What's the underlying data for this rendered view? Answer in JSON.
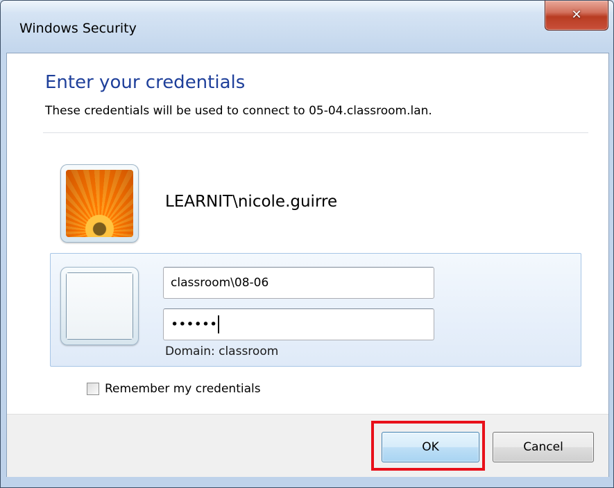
{
  "window": {
    "title": "Windows Security",
    "close_icon": "close-icon"
  },
  "dialog": {
    "heading": "Enter your credentials",
    "subtext": "These credentials will be used to connect to 05-04.classroom.lan."
  },
  "current_user": {
    "name": "LEARNIT\\nicole.guirre",
    "picture": "orange-flower-user-picture"
  },
  "credentials": {
    "username_value": "classroom\\08-06",
    "password_masked": "••••••",
    "domain_text": "Domain: classroom"
  },
  "remember": {
    "label": "Remember my credentials",
    "checked": false
  },
  "buttons": {
    "ok_label": "OK",
    "cancel_label": "Cancel"
  },
  "colors": {
    "heading": "#1e3f9a",
    "highlight": "#e8101a",
    "close_button": "#c9503a"
  }
}
